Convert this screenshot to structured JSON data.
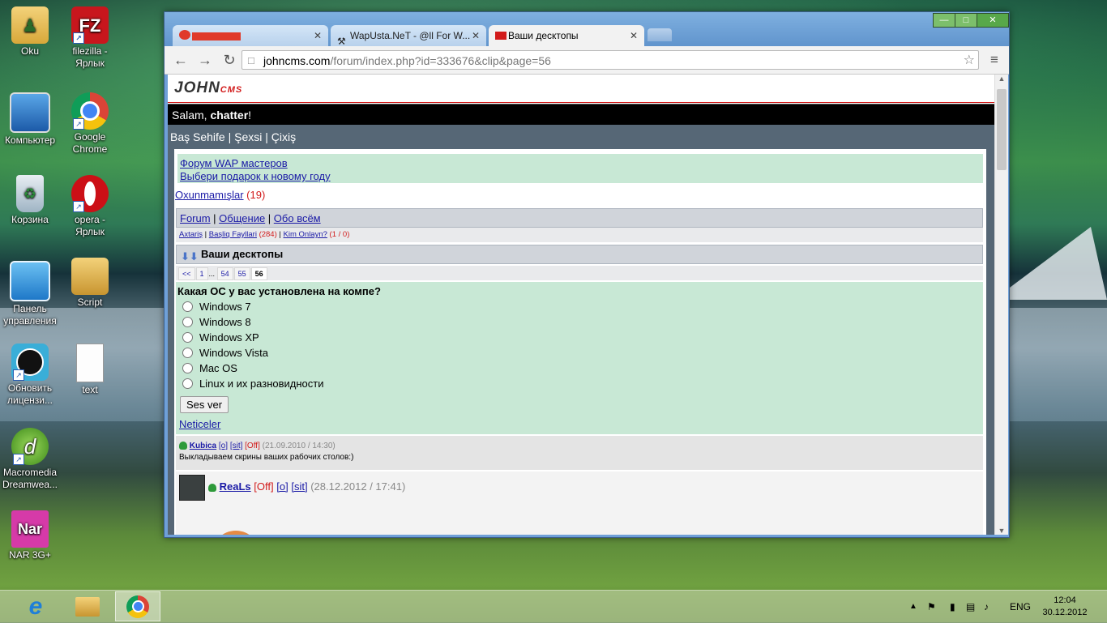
{
  "desktop": {
    "icons": [
      {
        "label": "Oku"
      },
      {
        "label": "filezilla - Ярлык"
      },
      {
        "label": "Компьютер"
      },
      {
        "label": "Google Chrome"
      },
      {
        "label": "Корзина"
      },
      {
        "label": "opera - Ярлык"
      },
      {
        "label": "Панель управления"
      },
      {
        "label": "Script"
      },
      {
        "label": "Обновить лицензи..."
      },
      {
        "label": "text"
      },
      {
        "label": "Macromedia Dreamwea..."
      },
      {
        "label": "NAR 3G+"
      }
    ]
  },
  "browser": {
    "tabs": [
      {
        "label": "",
        "icon": "red-favicon"
      },
      {
        "label": "WapUsta.NeT - @ll For W..."
      },
      {
        "label": "Ваши десктопы",
        "active": true
      }
    ],
    "url_host": "johncms.com",
    "url_path": "/forum/index.php?id=333676&clip&page=56"
  },
  "page": {
    "logo_main": "JOHN",
    "logo_sub": "CMS",
    "greeting_prefix": "Salam, ",
    "greeting_user": "chatter",
    "greeting_suffix": "!",
    "menu": {
      "home": "Baş Sehife",
      "sep1": " | ",
      "profile": "Şexsi",
      "sep2": " | ",
      "exit": "Çixiş"
    },
    "promo": [
      "Форум WAP мастеров",
      "Выбери подарок к новому году"
    ],
    "unread": {
      "label": "Oxunmamışlar",
      "count": "(19)"
    },
    "breadcrumb": {
      "forum": "Forum",
      "sep1": " | ",
      "general": "Общение",
      "sep2": " | ",
      "about": "Обо всём"
    },
    "sublinks": {
      "search": "Axtariş",
      "sep1": " | ",
      "files": "Başliq Fayllari",
      "files_count": "(284)",
      "sep2": " | ",
      "online": "Kim Onlayn?",
      "online_count": "(1 / 0)"
    },
    "topic_title": "Ваши десктопы",
    "pager": [
      "<<",
      "1",
      "...",
      "54",
      "55",
      "56"
    ],
    "poll": {
      "question": "Какая ОС у вас установлена на компе?",
      "options": [
        "Windows 7",
        "Windows 8",
        "Windows XP",
        "Windows Vista",
        "Mac OS",
        "Linux и их разновидности"
      ],
      "vote_button": "Ses ver",
      "results_link": "Neticeler"
    },
    "post1": {
      "user": "Kubica",
      "o": "[o]",
      "sit": "[sit]",
      "status": "[Off]",
      "date": "(21.09.2010 / 14:30)",
      "text": "Выкладываем скрины ваших рабочих столов:)"
    },
    "post2": {
      "user": "ReaLs",
      "status": "[Off]",
      "o": "[o]",
      "sit": "[sit]",
      "date": "(28.12.2012 / 17:41)"
    }
  },
  "taskbar": {
    "lang": "ENG",
    "time": "12:04",
    "date": "30.12.2012"
  },
  "colors": {
    "link": "#1a1aa6",
    "accent_red": "#d21b1b",
    "promo_bg": "#c8e8d5",
    "menu_bg": "#566776"
  }
}
